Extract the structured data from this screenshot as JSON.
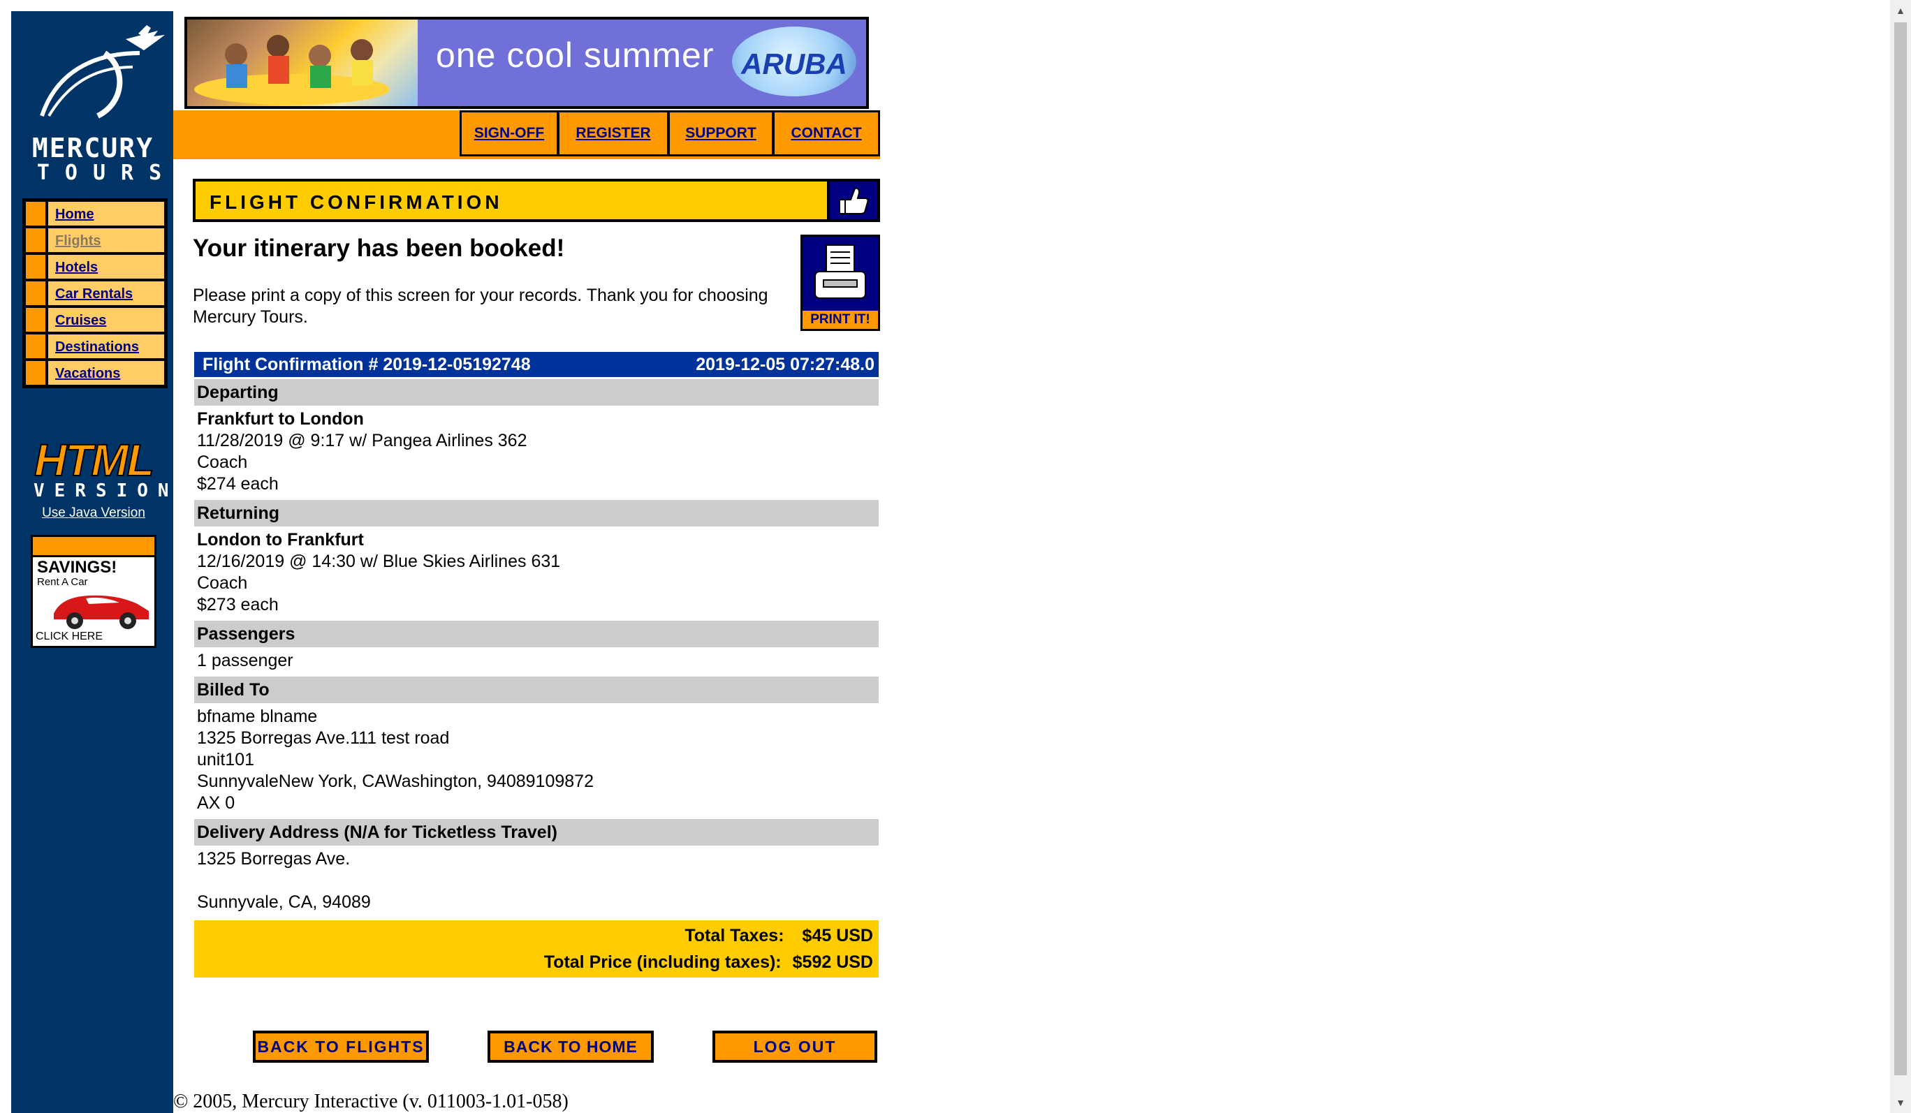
{
  "logo": {
    "line1": "MERCURY",
    "line2": "TOURS"
  },
  "sidebar_nav": [
    {
      "label": "Home",
      "visited": false
    },
    {
      "label": "Flights",
      "visited": true
    },
    {
      "label": "Hotels",
      "visited": false
    },
    {
      "label": "Car Rentals",
      "visited": false
    },
    {
      "label": "Cruises",
      "visited": false
    },
    {
      "label": "Destinations",
      "visited": false
    },
    {
      "label": "Vacations",
      "visited": false
    }
  ],
  "html_version": {
    "html": "HTML",
    "version": "VERSION",
    "java_link": "Use Java Version"
  },
  "savings_ad": {
    "title": "SAVINGS!",
    "subtitle": "Rent A Car",
    "cta": "CLICK HERE"
  },
  "banner": {
    "text": "one cool summer",
    "brand": "ARUBA"
  },
  "top_links": [
    "SIGN-OFF",
    "REGISTER",
    "SUPPORT",
    "CONTACT"
  ],
  "section_title": "FLIGHT CONFIRMATION",
  "booked": {
    "title": "Your itinerary has been booked!",
    "message": "Please print a copy of this screen for your records. Thank you for choosing Mercury Tours."
  },
  "print_label": "PRINT IT!",
  "confirmation": {
    "number": "Flight Confirmation # 2019-12-05192748",
    "datetime": "2019-12-05 07:27:48.0",
    "departing": {
      "header": "Departing",
      "route": "Frankfurt to London",
      "details": "11/28/2019 @ 9:17 w/ Pangea Airlines 362",
      "class": "Coach",
      "price": "$274 each"
    },
    "returning": {
      "header": "Returning",
      "route": "London to Frankfurt",
      "details": "12/16/2019 @ 14:30 w/ Blue Skies Airlines 631",
      "class": "Coach",
      "price": "$273 each"
    },
    "passengers": {
      "header": "Passengers",
      "value": "1 passenger"
    },
    "billed_to": {
      "header": "Billed To",
      "name": "bfname blname",
      "address1": "1325 Borregas Ave.111 test road",
      "address2": "unit101",
      "city_line": "SunnyvaleNew York, CAWashington, 94089109872",
      "card": "AX 0"
    },
    "delivery": {
      "header": "Delivery Address (N/A for Ticketless Travel)",
      "address1": "1325 Borregas Ave.",
      "city_line": "Sunnyvale, CA, 94089"
    },
    "totals": {
      "tax_label": "Total Taxes:",
      "tax_value": "$45 USD",
      "price_label": "Total Price (including taxes):",
      "price_value": "$592 USD"
    }
  },
  "buttons": {
    "back_flights": "BACK TO FLIGHTS",
    "back_home": "BACK TO HOME",
    "logout": "LOG OUT"
  },
  "copyright": "© 2005, Mercury Interactive (v. 011003-1.01-058)",
  "colors": {
    "sidebar": "#003366",
    "orange": "#ff9900",
    "yellow": "#ffcc00",
    "nav_blue": "#000080",
    "conf_header": "#003399",
    "section_gray": "#cccccc"
  }
}
